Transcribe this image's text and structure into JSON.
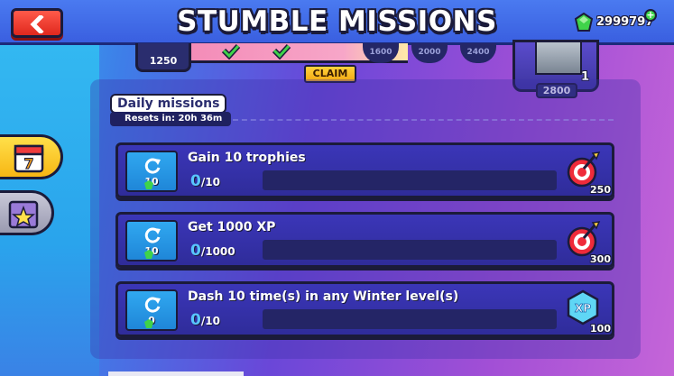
{
  "header": {
    "title": "STUMBLE MISSIONS",
    "back_icon": "chevron-left-icon",
    "gems": "2999797",
    "gem_icon": "green-gem-icon",
    "plus_icon": "plus-icon"
  },
  "milestones": {
    "trophy_total": "1250",
    "claim_label": "CLAIM",
    "values": [
      "1600",
      "2000",
      "2400"
    ],
    "chest_count": "1",
    "chest_value": "2800"
  },
  "section": {
    "title": "Daily missions",
    "reset_text": "Resets in:  20h 36m"
  },
  "missions": [
    {
      "title": "Gain 10 trophies",
      "current": "0",
      "total": "/10",
      "reroll_cost": "10",
      "reward_type": "trophy-target-icon",
      "reward_amount": "250",
      "progress": 0
    },
    {
      "title": "Get 1000 XP",
      "current": "0",
      "total": "/1000",
      "reroll_cost": "10",
      "reward_type": "trophy-target-icon",
      "reward_amount": "300",
      "progress": 0
    },
    {
      "title": "Dash 10 time(s) in any  Winter level(s)",
      "current": "0",
      "total": "/10",
      "reroll_cost": "0",
      "reward_type": "xp-badge-icon",
      "reward_amount": "100",
      "progress": 0
    }
  ],
  "colors": {
    "accent_gold": "#f7b614",
    "progress_blue": "#58c6ff",
    "card_blue": "#3b36b8"
  }
}
